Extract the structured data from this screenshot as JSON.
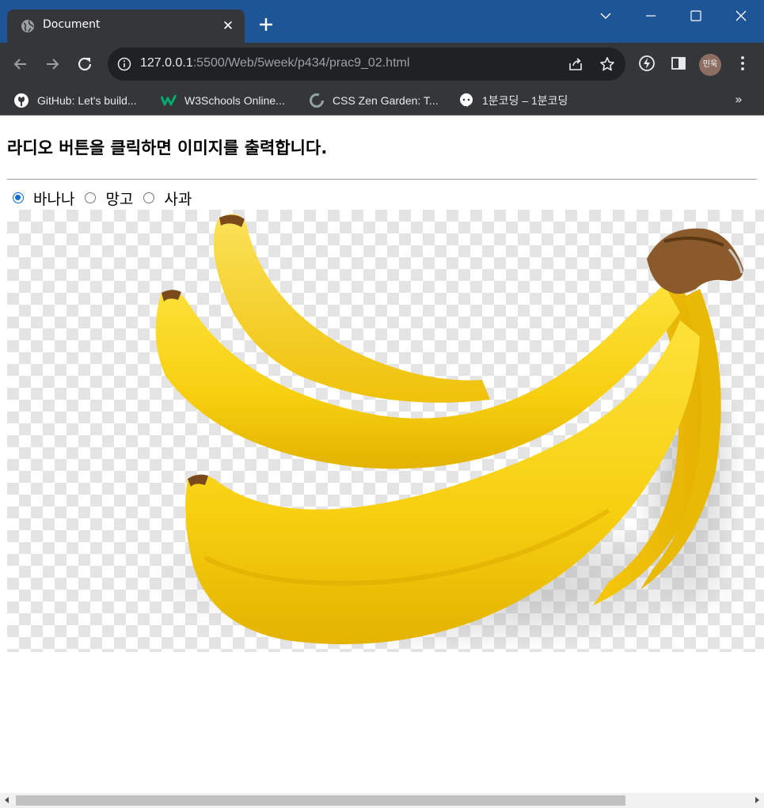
{
  "browser": {
    "tab_title": "Document",
    "url_host": "127.0.0.1",
    "url_path": ":5500/Web/5week/p434/prac9_02.html",
    "profile_label": "민욱",
    "accent_color": "#1e5596",
    "bookmarks": [
      {
        "label": "GitHub: Let's build...",
        "icon": "github-icon"
      },
      {
        "label": "W3Schools Online...",
        "icon": "w3schools-icon"
      },
      {
        "label": "CSS Zen Garden: T...",
        "icon": "zen-garden-icon"
      },
      {
        "label": "1분코딩 – 1분코딩",
        "icon": "1bun-coding-icon"
      }
    ],
    "bookmarks_overflow": "»"
  },
  "page": {
    "heading": "라디오 버튼을 클릭하면 이미지를 출력합니다.",
    "radio_options": [
      {
        "label": "바나나",
        "checked": true
      },
      {
        "label": "망고",
        "checked": false
      },
      {
        "label": "사과",
        "checked": false
      }
    ],
    "image_subject": "banana-bunch"
  }
}
